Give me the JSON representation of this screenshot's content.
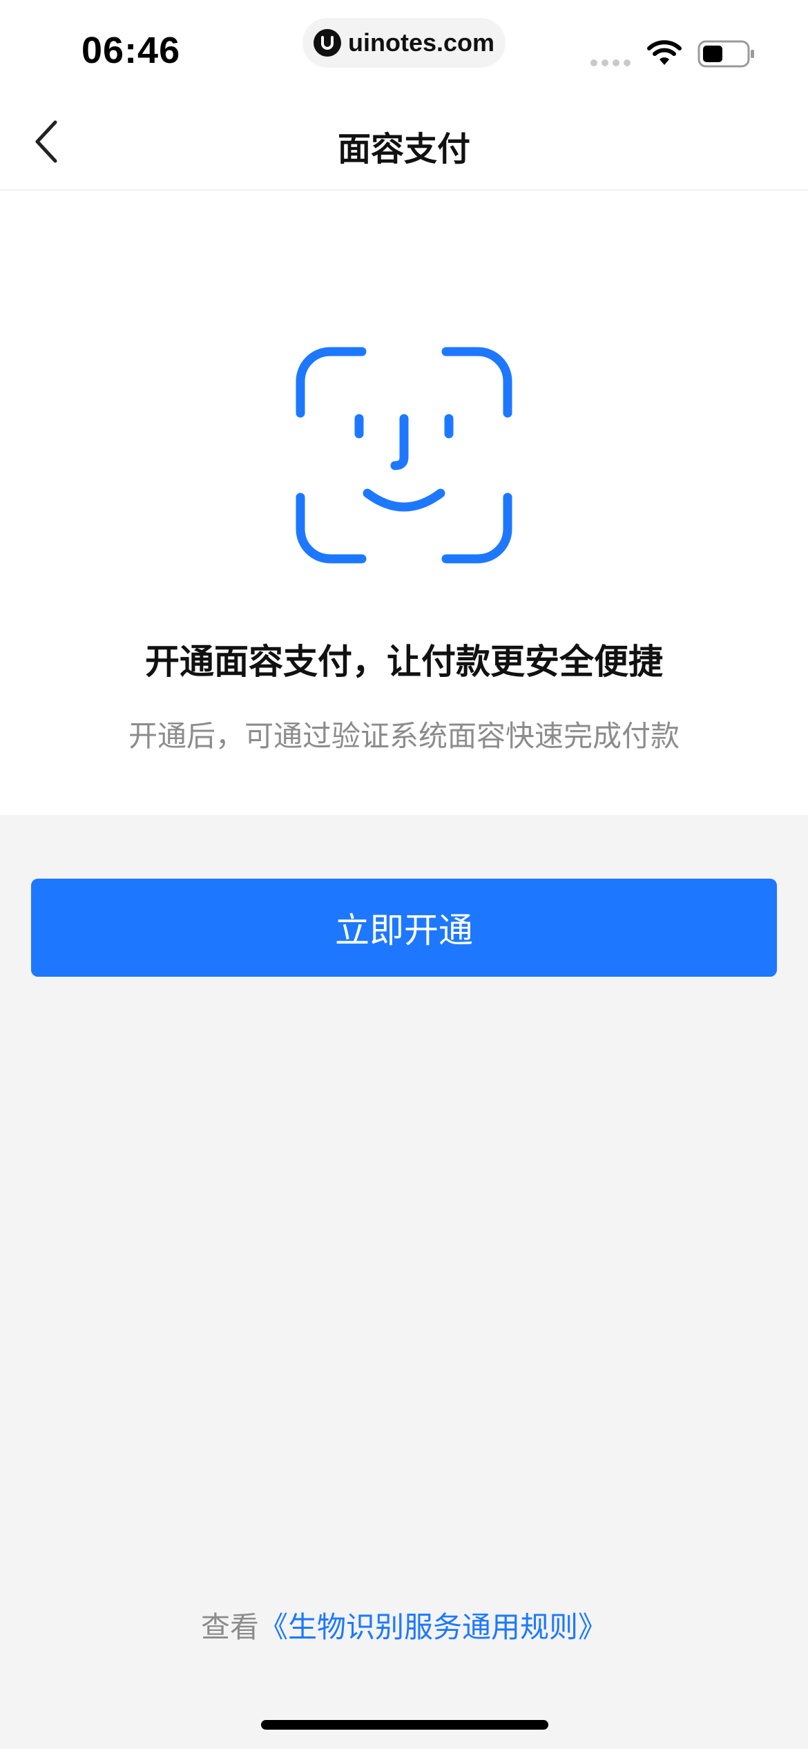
{
  "status_bar": {
    "time": "06:46",
    "url": "uinotes.com",
    "icons": [
      "signal-icon",
      "wifi-icon",
      "battery-icon"
    ]
  },
  "nav": {
    "title": "面容支付",
    "back_icon": "chevron-left-icon"
  },
  "main": {
    "icon": "face-id-icon",
    "headline": "开通面容支付，让付款更安全便捷",
    "subtext": "开通后，可通过验证系统面容快速完成付款"
  },
  "actions": {
    "activate_label": "立即开通"
  },
  "footer": {
    "prefix": "查看",
    "link": "《生物识别服务通用规则》"
  },
  "colors": {
    "accent": "#1d78ff",
    "background": "#f4f4f4",
    "card": "#ffffff",
    "secondary_text": "#8c8c8c"
  }
}
